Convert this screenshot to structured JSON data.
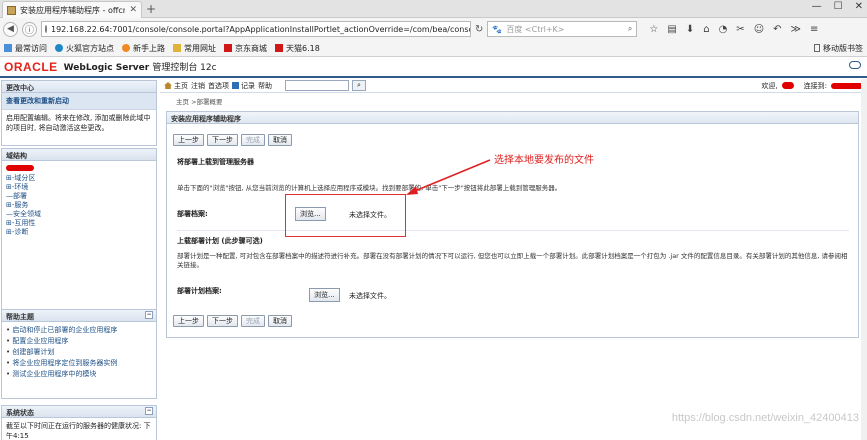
{
  "browser": {
    "tab_title": "安装应用程序辅助程序 - offcn-1",
    "url": "192.168.22.64:7001/console/console.portal?AppApplicationInstallPortlet_actionOverride=/com/bea/console/a",
    "search_placeholder": "百度 <Ctrl+K>",
    "bookmarks": [
      {
        "label": "最常访问"
      },
      {
        "label": "火狐官方站点"
      },
      {
        "label": "新手上路"
      },
      {
        "label": "常用网址"
      },
      {
        "label": "京东商城"
      },
      {
        "label": "天猫6.18"
      }
    ],
    "mobile_bookmarks": "移动版书签"
  },
  "header": {
    "brand": "ORACLE",
    "product": "WebLogic Server",
    "product_sub": "管理控制台 12c"
  },
  "toolbar": {
    "home": "主页",
    "logout": "注销",
    "prefs": "首选项",
    "record": "记录",
    "help": "帮助",
    "welcome": "欢迎,",
    "connected": "连接到:"
  },
  "breadcrumb": "主页 >部署概要",
  "change_center": {
    "title": "更改中心",
    "lock_link": "查看更改和重新启动",
    "desc": "启用配置编辑。将来在修改, 添加或删除此域中的项目时, 将自动激活这些更改。"
  },
  "domain_structure": {
    "title": "域结构",
    "items": [
      "⊞-域分区",
      "⊞-环境",
      "—部署",
      "⊞-服务",
      "—安全领域",
      "⊞-互用性",
      "⊞-诊断"
    ]
  },
  "help_topics": {
    "title": "帮助主题",
    "items": [
      "启动和停止已部署的企业应用程序",
      "配置企业应用程序",
      "创建部署计划",
      "将企业应用程序定位到服务器实例",
      "测试企业应用程序中的模块"
    ]
  },
  "system_status": {
    "title": "系统状态",
    "desc": "截至以下时间正在运行的服务器的健康状况: 下午4:15"
  },
  "assistant": {
    "title": "安装应用程序辅助程序",
    "buttons": {
      "back": "上一步",
      "next": "下一步",
      "finish": "完成",
      "cancel": "取消"
    },
    "upload_section": "将部署上载到管理服务器",
    "upload_desc": "单击下面的\"浏览\"按钮, 从您当前浏览的计算机上选择应用程序或模块。找到要部署的, 单击\"下一步\"按钮将此部署上载到管理服务器。",
    "archive_label": "部署档案:",
    "browse": "浏览...",
    "no_file": "未选择文件。",
    "plan_section": "上载部署计划 (此步骤可选)",
    "plan_desc": "部署计划是一种配置, 可对包含在部署档案中的描述符进行补充。部署在没有部署计划的情况下可以运行, 但您也可以立即上载一个部署计划。此部署计划档案是一个打包为 .jar 文件的配置信息目录。有关部署计划的其他信息, 请参阅相关链接。",
    "plan_label": "部署计划档案:"
  },
  "annotation": "选择本地要发布的文件",
  "watermark": "https://blog.csdn.net/weixin_42400413"
}
